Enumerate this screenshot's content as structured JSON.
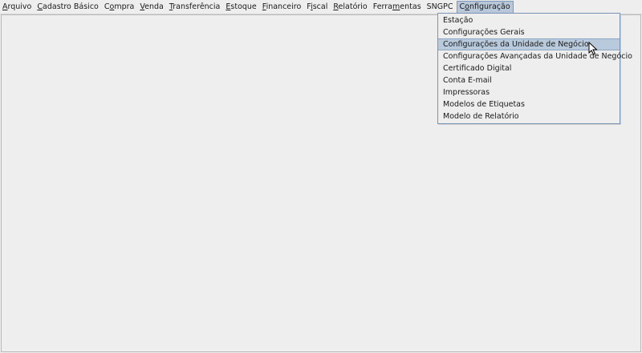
{
  "menubar": {
    "items": [
      {
        "pre": "",
        "u": "A",
        "post": "rquivo"
      },
      {
        "pre": "",
        "u": "C",
        "post": "adastro Básico"
      },
      {
        "pre": "C",
        "u": "o",
        "post": "mpra"
      },
      {
        "pre": "",
        "u": "V",
        "post": "enda"
      },
      {
        "pre": "",
        "u": "T",
        "post": "ransferência"
      },
      {
        "pre": "",
        "u": "E",
        "post": "stoque"
      },
      {
        "pre": "",
        "u": "F",
        "post": "inanceiro"
      },
      {
        "pre": "F",
        "u": "i",
        "post": "scal"
      },
      {
        "pre": "",
        "u": "R",
        "post": "elatório"
      },
      {
        "pre": "Ferra",
        "u": "m",
        "post": "entas"
      },
      {
        "pre": "SNGPC",
        "u": "",
        "post": ""
      },
      {
        "pre": "C",
        "u": "o",
        "post": "nfiguração"
      }
    ]
  },
  "dropdown": {
    "items": [
      "Estação",
      "Configurações Gerais",
      "Configurações da Unidade de Negócio",
      "Configurações Avançadas da Unidade de Negócio",
      "Certificado Digital",
      "Conta E-mail",
      "Impressoras",
      "Modelos de Etiquetas",
      "Modelo de Relatório"
    ]
  }
}
